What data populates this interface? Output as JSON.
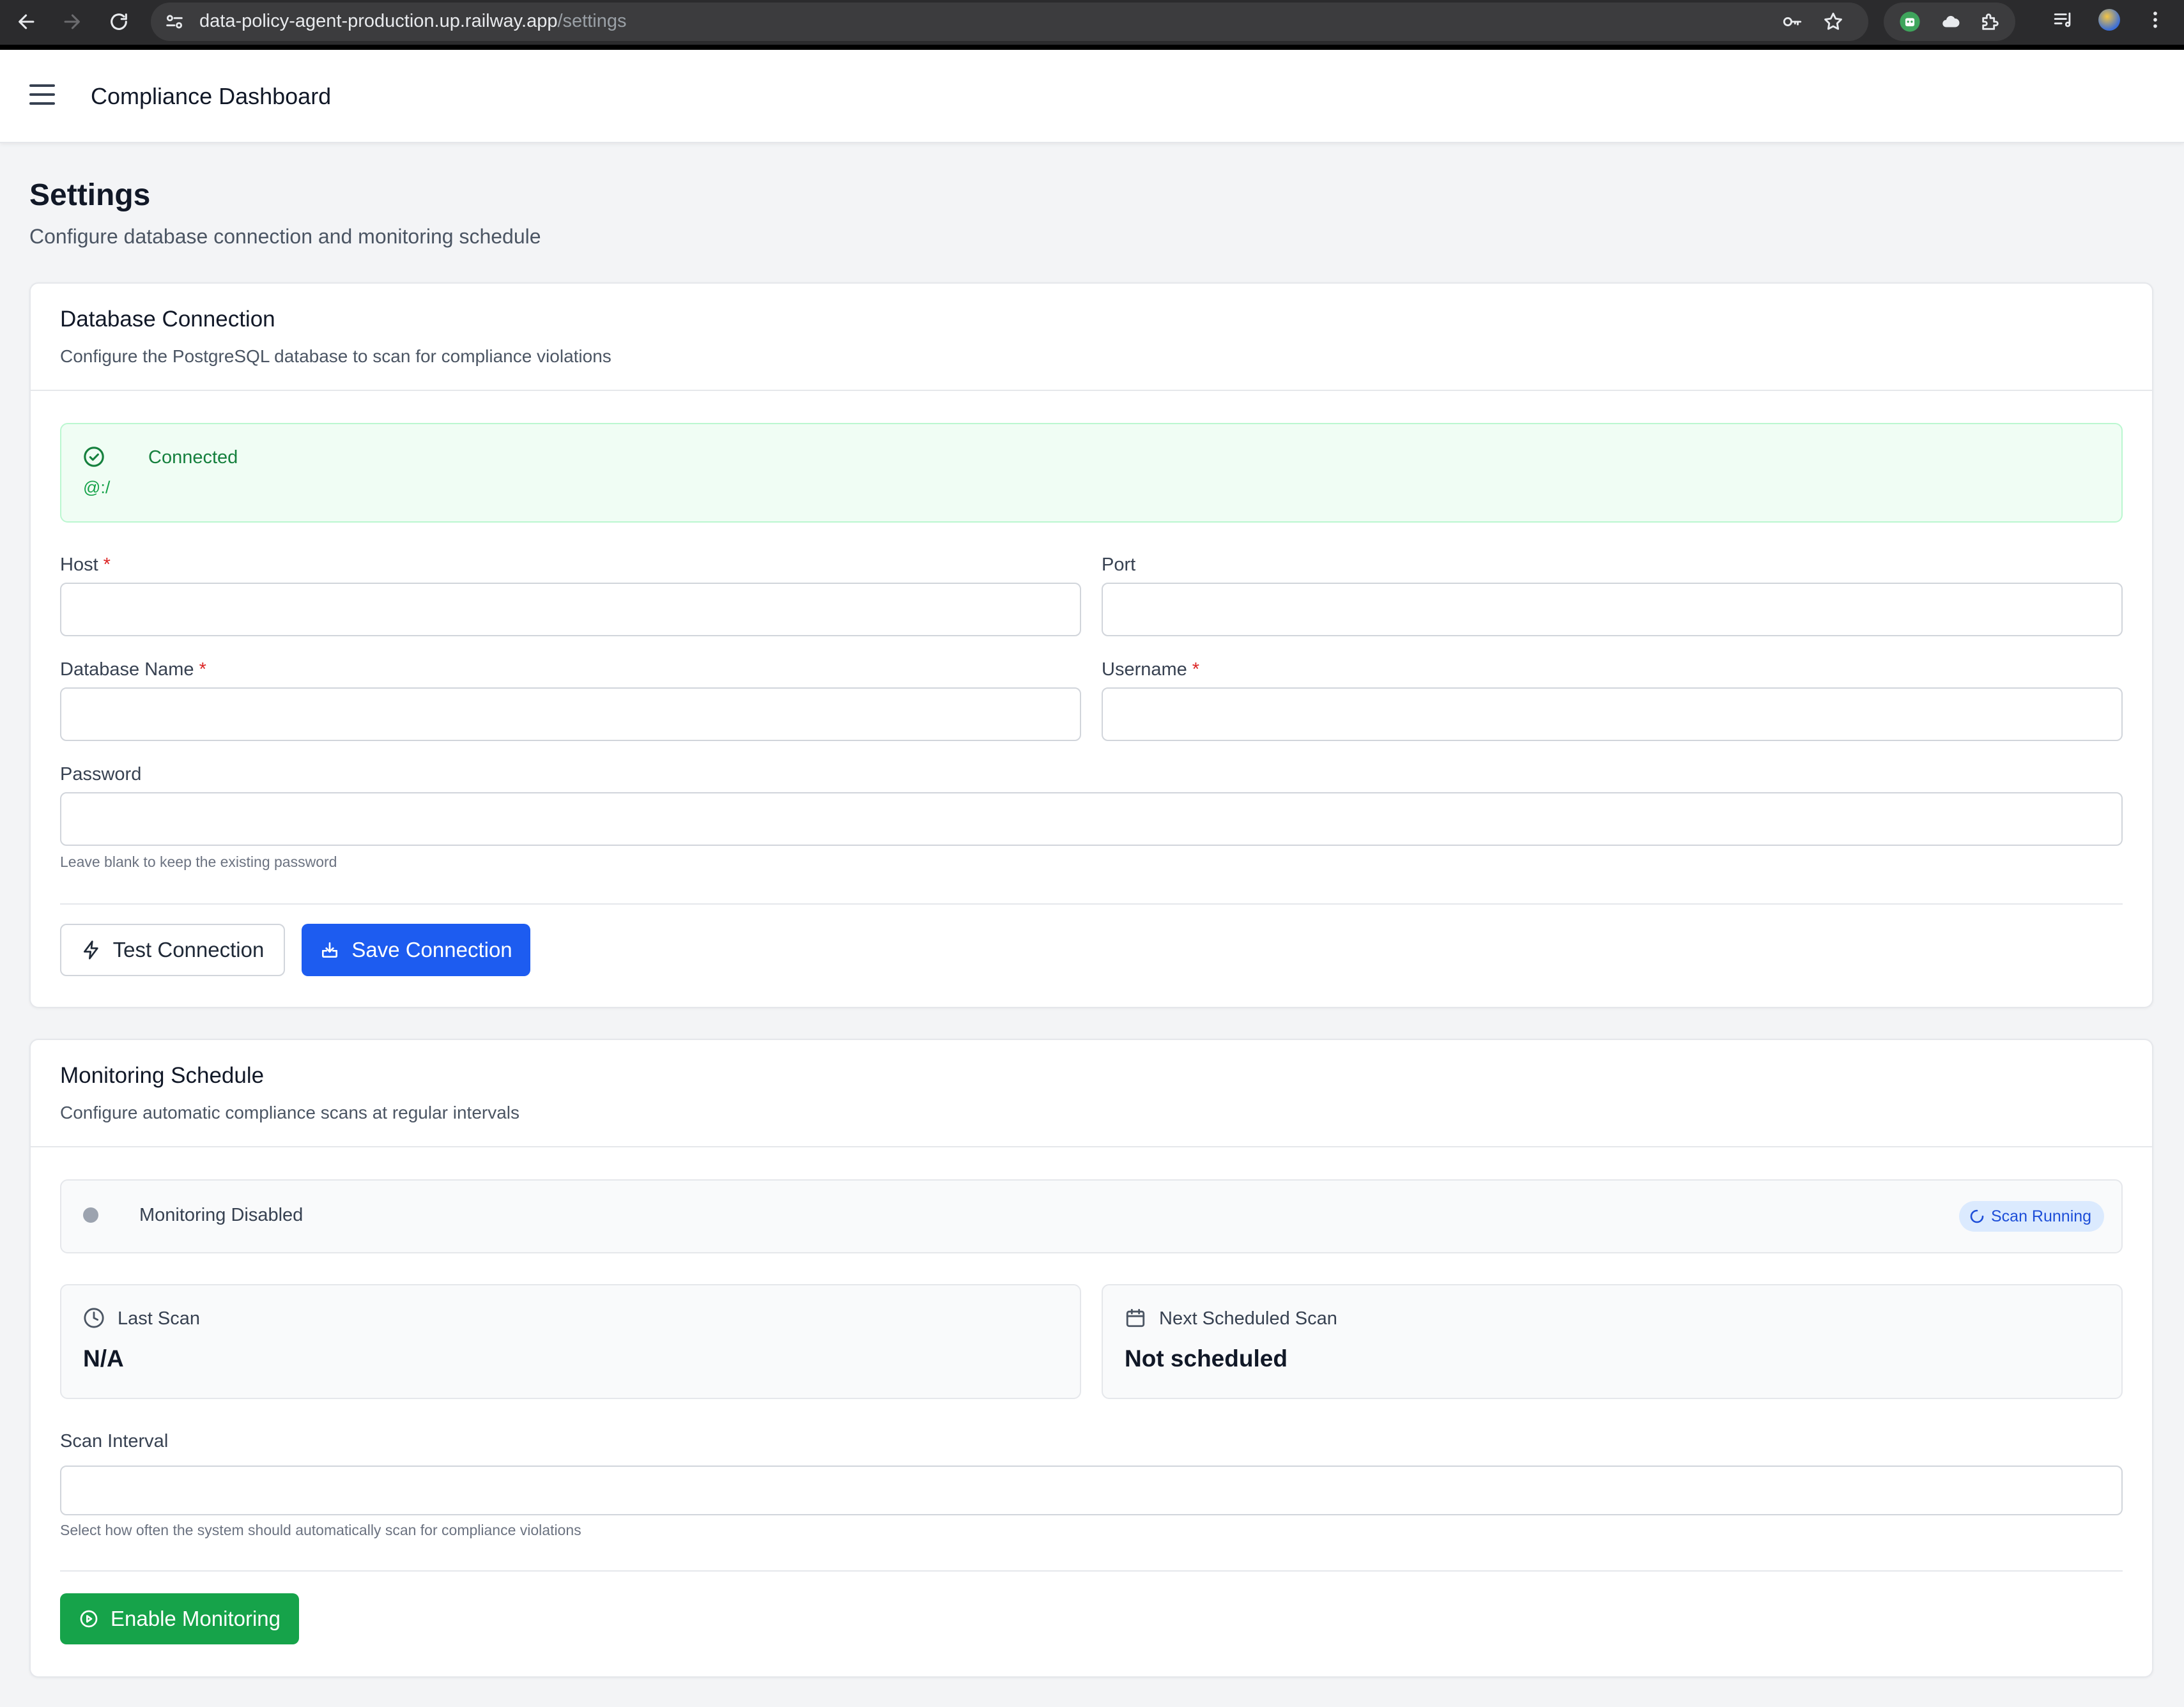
{
  "browser": {
    "url_host": "data-policy-agent-production.up.railway.app",
    "url_path": "/settings"
  },
  "header": {
    "title": "Compliance Dashboard"
  },
  "page": {
    "title": "Settings",
    "subtitle": "Configure database connection and monitoring schedule"
  },
  "database": {
    "title": "Database Connection",
    "description": "Configure the PostgreSQL database to scan for compliance violations",
    "status_label": "Connected",
    "status_detail": "@:/",
    "status_color": "#15803d",
    "fields": {
      "host": {
        "label": "Host",
        "required": "*",
        "value": ""
      },
      "port": {
        "label": "Port",
        "value": ""
      },
      "db_name": {
        "label": "Database Name",
        "required": "*",
        "value": ""
      },
      "username": {
        "label": "Username",
        "required": "*",
        "value": ""
      },
      "password": {
        "label": "Password",
        "value": "",
        "hint": "Leave blank to keep the existing password"
      }
    },
    "test_button": "Test Connection",
    "save_button": "Save Connection"
  },
  "monitoring": {
    "title": "Monitoring Schedule",
    "description": "Configure automatic compliance scans at regular intervals",
    "status_label": "Monitoring Disabled",
    "badge": "Scan Running",
    "last_scan": {
      "label": "Last Scan",
      "value": "N/A"
    },
    "next_scan": {
      "label": "Next Scheduled Scan",
      "value": "Not scheduled"
    },
    "interval": {
      "label": "Scan Interval",
      "value": "",
      "hint": "Select how often the system should automatically scan for compliance violations"
    },
    "enable_button": "Enable Monitoring"
  },
  "colors": {
    "primary": "#1d5cf0",
    "success": "#16a34a",
    "danger": "#dc2626"
  }
}
